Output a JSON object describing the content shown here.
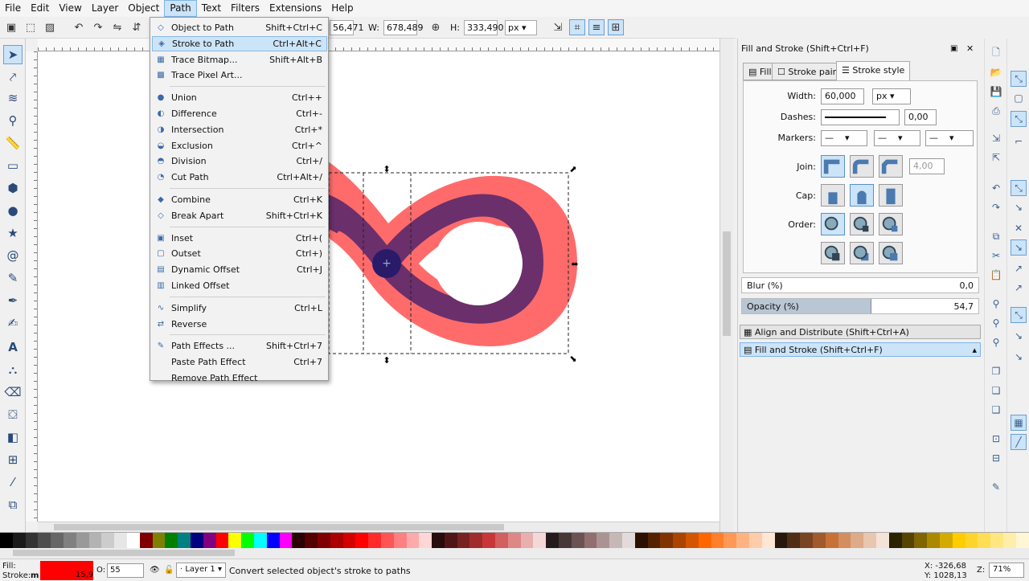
{
  "menubar": [
    "File",
    "Edit",
    "View",
    "Layer",
    "Object",
    "Path",
    "Text",
    "Filters",
    "Extensions",
    "Help"
  ],
  "active_menu": "Path",
  "toolbar": {
    "x_value": "56,471",
    "w_label": "W:",
    "w_value": "678,489",
    "h_label": "H:",
    "h_value": "333,490",
    "unit": "px"
  },
  "path_menu": [
    {
      "label": "Object to Path",
      "shortcut": "Shift+Ctrl+C",
      "icon": "object-to-path-icon",
      "glyph": "◇"
    },
    {
      "label": "Stroke to Path",
      "shortcut": "Ctrl+Alt+C",
      "icon": "stroke-to-path-icon",
      "glyph": "◈",
      "highlight": true
    },
    {
      "label": "Trace Bitmap...",
      "shortcut": "Shift+Alt+B",
      "icon": "trace-bitmap-icon",
      "glyph": "▦"
    },
    {
      "label": "Trace Pixel Art...",
      "shortcut": "",
      "icon": "trace-pixel-art-icon",
      "glyph": "▩"
    },
    {
      "sep": true
    },
    {
      "label": "Union",
      "shortcut": "Ctrl++",
      "icon": "union-icon",
      "glyph": "●"
    },
    {
      "label": "Difference",
      "shortcut": "Ctrl+-",
      "icon": "difference-icon",
      "glyph": "◐"
    },
    {
      "label": "Intersection",
      "shortcut": "Ctrl+*",
      "icon": "intersection-icon",
      "glyph": "◑"
    },
    {
      "label": "Exclusion",
      "shortcut": "Ctrl+^",
      "icon": "exclusion-icon",
      "glyph": "◒"
    },
    {
      "label": "Division",
      "shortcut": "Ctrl+/",
      "icon": "division-icon",
      "glyph": "◓"
    },
    {
      "label": "Cut Path",
      "shortcut": "Ctrl+Alt+/",
      "icon": "cut-path-icon",
      "glyph": "◔"
    },
    {
      "sep": true
    },
    {
      "label": "Combine",
      "shortcut": "Ctrl+K",
      "icon": "combine-icon",
      "glyph": "◆"
    },
    {
      "label": "Break Apart",
      "shortcut": "Shift+Ctrl+K",
      "icon": "break-apart-icon",
      "glyph": "◇"
    },
    {
      "sep": true
    },
    {
      "label": "Inset",
      "shortcut": "Ctrl+(",
      "icon": "inset-icon",
      "glyph": "▣"
    },
    {
      "label": "Outset",
      "shortcut": "Ctrl+)",
      "icon": "outset-icon",
      "glyph": "▢"
    },
    {
      "label": "Dynamic Offset",
      "shortcut": "Ctrl+J",
      "icon": "dynamic-offset-icon",
      "glyph": "▤"
    },
    {
      "label": "Linked Offset",
      "shortcut": "",
      "icon": "linked-offset-icon",
      "glyph": "▥"
    },
    {
      "sep": true
    },
    {
      "label": "Simplify",
      "shortcut": "Ctrl+L",
      "icon": "simplify-icon",
      "glyph": "∿"
    },
    {
      "label": "Reverse",
      "shortcut": "",
      "icon": "reverse-icon",
      "glyph": "⇄"
    },
    {
      "sep": true
    },
    {
      "label": "Path Effects ...",
      "shortcut": "Shift+Ctrl+7",
      "icon": "path-effects-icon",
      "glyph": "✎"
    },
    {
      "label": "Paste Path Effect",
      "shortcut": "Ctrl+7",
      "icon": "",
      "glyph": ""
    },
    {
      "label": "Remove Path Effect",
      "shortcut": "",
      "icon": "",
      "glyph": ""
    }
  ],
  "dock": {
    "title": "Fill and Stroke (Shift+Ctrl+F)",
    "tabs": [
      "Fill",
      "Stroke paint",
      "Stroke style"
    ],
    "width_label": "Width:",
    "width_value": "60,000",
    "width_unit": "px",
    "dashes_label": "Dashes:",
    "dashes_value": "0,00",
    "markers_label": "Markers:",
    "join_label": "Join:",
    "miter_value": "4,00",
    "cap_label": "Cap:",
    "order_label": "Order:",
    "blur_label": "Blur (%)",
    "blur_value": "0,0",
    "opacity_label": "Opacity (%)",
    "opacity_value": "54,7",
    "opacity_level": 0.547,
    "collapsed_panels": [
      "Align and Distribute (Shift+Ctrl+A)",
      "Fill and Stroke (Shift+Ctrl+F)"
    ]
  },
  "status": {
    "fill_label": "Fill:",
    "stroke_label": "Stroke:",
    "fill_short": "m",
    "stroke_short": "m",
    "stroke_width": "15,9",
    "opacity_label": "O:",
    "opacity_value": "55",
    "layer": "Layer 1",
    "message": "Convert selected object's stroke to paths",
    "x_coord": "X: -326,68",
    "y_coord": "Y: 1028,13",
    "zoom_label": "Z:",
    "zoom_value": "71%"
  },
  "colors": {
    "fill_swatch": "#ff0000",
    "outer_stroke": "#ff6b6b",
    "inner_stroke": "#6b2f6b",
    "center": "#2a1a6a",
    "palette": [
      "#000000",
      "#1a1a1a",
      "#333333",
      "#4d4d4d",
      "#666666",
      "#808080",
      "#999999",
      "#b3b3b3",
      "#cccccc",
      "#e6e6e6",
      "#ffffff",
      "#800000",
      "#808000",
      "#008000",
      "#008080",
      "#000080",
      "#800080",
      "#ff0000",
      "#ffff00",
      "#00ff00",
      "#00ffff",
      "#0000ff",
      "#ff00ff",
      "#2b0000",
      "#550000",
      "#800000",
      "#aa0000",
      "#d40000",
      "#ff0000",
      "#ff2a2a",
      "#ff5555",
      "#ff8080",
      "#ffaaaa",
      "#ffd5d5",
      "#280b0b",
      "#501616",
      "#782121",
      "#a02c2c",
      "#c83737",
      "#d35f5f",
      "#de8787",
      "#e9afaf",
      "#f4d7d7",
      "#241c1c",
      "#483737",
      "#6c5353",
      "#916f6f",
      "#ac9393",
      "#c8b7b7",
      "#e3dbdb",
      "#2b1100",
      "#552200",
      "#803300",
      "#aa4400",
      "#d45500",
      "#ff6600",
      "#ff7f2a",
      "#ff9955",
      "#ffb380",
      "#ffccaa",
      "#ffe6d5",
      "#28170b",
      "#502d16",
      "#784421",
      "#a05a2c",
      "#c87137",
      "#d38d5f",
      "#deaa87",
      "#e9c6af",
      "#f4e3d7",
      "#2b2200",
      "#554400",
      "#806600",
      "#aa8800",
      "#d4aa00",
      "#ffcc00",
      "#ffd42a",
      "#ffdd55",
      "#ffe680",
      "#ffeeaa",
      "#fff6d5"
    ]
  }
}
